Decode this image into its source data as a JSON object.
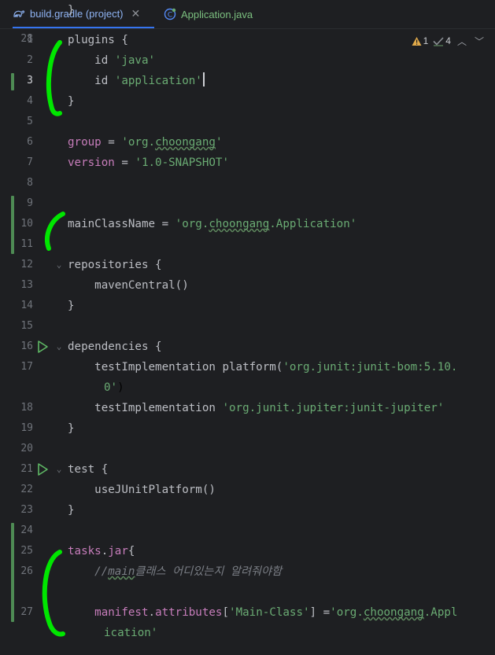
{
  "tabs": [
    {
      "label": "build.gradle (project)",
      "icon": "gradle-icon",
      "active": true
    },
    {
      "label": "Application.java",
      "icon": "java-class-icon",
      "active": false
    }
  ],
  "inspections": {
    "warnings": "1",
    "weak_warnings": "4"
  },
  "current_line": 3,
  "lines": [
    {
      "number": "1",
      "segments": [
        {
          "text": "plugins {",
          "kind": "default"
        }
      ]
    },
    {
      "number": "2",
      "segments": [
        {
          "text": "    id ",
          "kind": "default"
        },
        {
          "text": "'java'",
          "kind": "string"
        }
      ]
    },
    {
      "number": "3",
      "segments": [
        {
          "text": "    id ",
          "kind": "default"
        },
        {
          "text": "'application'",
          "kind": "string"
        }
      ]
    },
    {
      "number": "4",
      "segments": [
        {
          "text": "}",
          "kind": "default"
        }
      ]
    },
    {
      "number": "5",
      "segments": []
    },
    {
      "number": "6",
      "segments": [
        {
          "text": "group",
          "kind": "property"
        },
        {
          "text": " = ",
          "kind": "default"
        },
        {
          "text": "'org.",
          "kind": "string"
        },
        {
          "text": "choongang",
          "kind": "string-warn"
        },
        {
          "text": "'",
          "kind": "string"
        }
      ]
    },
    {
      "number": "7",
      "segments": [
        {
          "text": "version",
          "kind": "property"
        },
        {
          "text": " = ",
          "kind": "default"
        },
        {
          "text": "'1.0-SNAPSHOT'",
          "kind": "string"
        }
      ]
    },
    {
      "number": "8",
      "segments": []
    },
    {
      "number": "9",
      "segments": []
    },
    {
      "number": "10",
      "segments": [
        {
          "text": "mainClassName",
          "kind": "default"
        },
        {
          "text": " = ",
          "kind": "default"
        },
        {
          "text": "'org.",
          "kind": "string"
        },
        {
          "text": "choongang",
          "kind": "string-warn"
        },
        {
          "text": ".Application'",
          "kind": "string"
        }
      ]
    },
    {
      "number": "11",
      "segments": []
    },
    {
      "number": "12",
      "segments": [
        {
          "text": "repositories {",
          "kind": "default"
        }
      ]
    },
    {
      "number": "13",
      "segments": [
        {
          "text": "    mavenCentral()",
          "kind": "default"
        }
      ]
    },
    {
      "number": "14",
      "segments": [
        {
          "text": "}",
          "kind": "default"
        }
      ]
    },
    {
      "number": "15",
      "segments": []
    },
    {
      "number": "16",
      "segments": [
        {
          "text": "dependencies {",
          "kind": "default"
        }
      ]
    },
    {
      "number": "17",
      "segments": [
        {
          "text": "    testImplementation platform(",
          "kind": "default"
        },
        {
          "text": "'org.junit:junit-bom:5.10.",
          "kind": "string"
        }
      ],
      "continuation": [
        {
          "text": "0'",
          "kind": "string"
        },
        {
          "text": ")",
          "kind": "default"
        }
      ]
    },
    {
      "number": "18",
      "segments": [
        {
          "text": "    testImplementation ",
          "kind": "default"
        },
        {
          "text": "'org.junit.jupiter:junit-jupiter'",
          "kind": "string"
        }
      ]
    },
    {
      "number": "19",
      "segments": [
        {
          "text": "}",
          "kind": "default"
        }
      ]
    },
    {
      "number": "20",
      "segments": []
    },
    {
      "number": "21",
      "segments": [
        {
          "text": "test {",
          "kind": "default"
        }
      ]
    },
    {
      "number": "22",
      "segments": [
        {
          "text": "    useJUnitPlatform()",
          "kind": "default"
        }
      ]
    },
    {
      "number": "23",
      "segments": [
        {
          "text": "}",
          "kind": "default"
        }
      ]
    },
    {
      "number": "24",
      "segments": []
    },
    {
      "number": "25",
      "segments": [
        {
          "text": "tasks",
          "kind": "property"
        },
        {
          "text": ".",
          "kind": "default"
        },
        {
          "text": "jar",
          "kind": "property"
        },
        {
          "text": "{",
          "kind": "default"
        }
      ]
    },
    {
      "number": "26",
      "segments": [
        {
          "text": "    //",
          "kind": "comment"
        },
        {
          "text": "main",
          "kind": "comment-warn"
        },
        {
          "text": "클래스 어디있는지 알려줘야함",
          "kind": "comment"
        }
      ]
    },
    {
      "number": "27",
      "segments": [
        {
          "text": "    ",
          "kind": "default"
        },
        {
          "text": "manifest",
          "kind": "property"
        },
        {
          "text": ".",
          "kind": "default"
        },
        {
          "text": "attributes",
          "kind": "property"
        },
        {
          "text": "[",
          "kind": "default"
        },
        {
          "text": "'Main-Class'",
          "kind": "string"
        },
        {
          "text": "] =",
          "kind": "default"
        },
        {
          "text": "'org.",
          "kind": "string"
        },
        {
          "text": "choongang",
          "kind": "string-warn"
        },
        {
          "text": ".Appl",
          "kind": "string"
        }
      ],
      "continuation": [
        {
          "text": "ication'",
          "kind": "string"
        }
      ]
    },
    {
      "number": "28",
      "segments": [
        {
          "text": "}",
          "kind": "default"
        }
      ]
    }
  ]
}
